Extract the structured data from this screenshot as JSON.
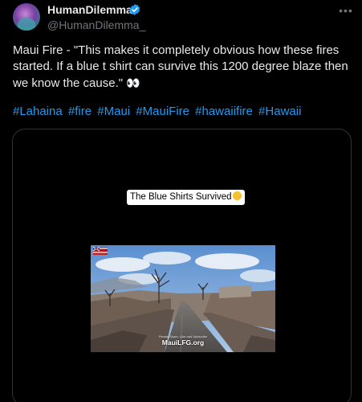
{
  "author": {
    "display_name": "HumanDilemma",
    "handle": "@HumanDilemma_",
    "verified": true
  },
  "tweet": {
    "text": "Maui Fire - \"This makes it completely obvious how these fires started. If a blue t shirt can survive this 1200 degree blaze then we know the cause.\"",
    "emoji": "👀",
    "hashtags": [
      "#Lahaina",
      "#fire",
      "#Maui",
      "#MauiFire",
      "#hawaiifire",
      "#Hawaii"
    ]
  },
  "media": {
    "caption": "The Blue Shirts Survived",
    "credit_small": "Please Share, Like and Subscribe",
    "credit_site": "MauiLFG.org"
  },
  "icons": {
    "verified": "verified-badge-icon",
    "more": "more-options-icon",
    "flag": "hawaii-flag-icon"
  },
  "colors": {
    "background": "#000000",
    "text": "#e7e9ea",
    "muted": "#71767b",
    "link": "#1d9bf0",
    "border": "#2f3336"
  }
}
